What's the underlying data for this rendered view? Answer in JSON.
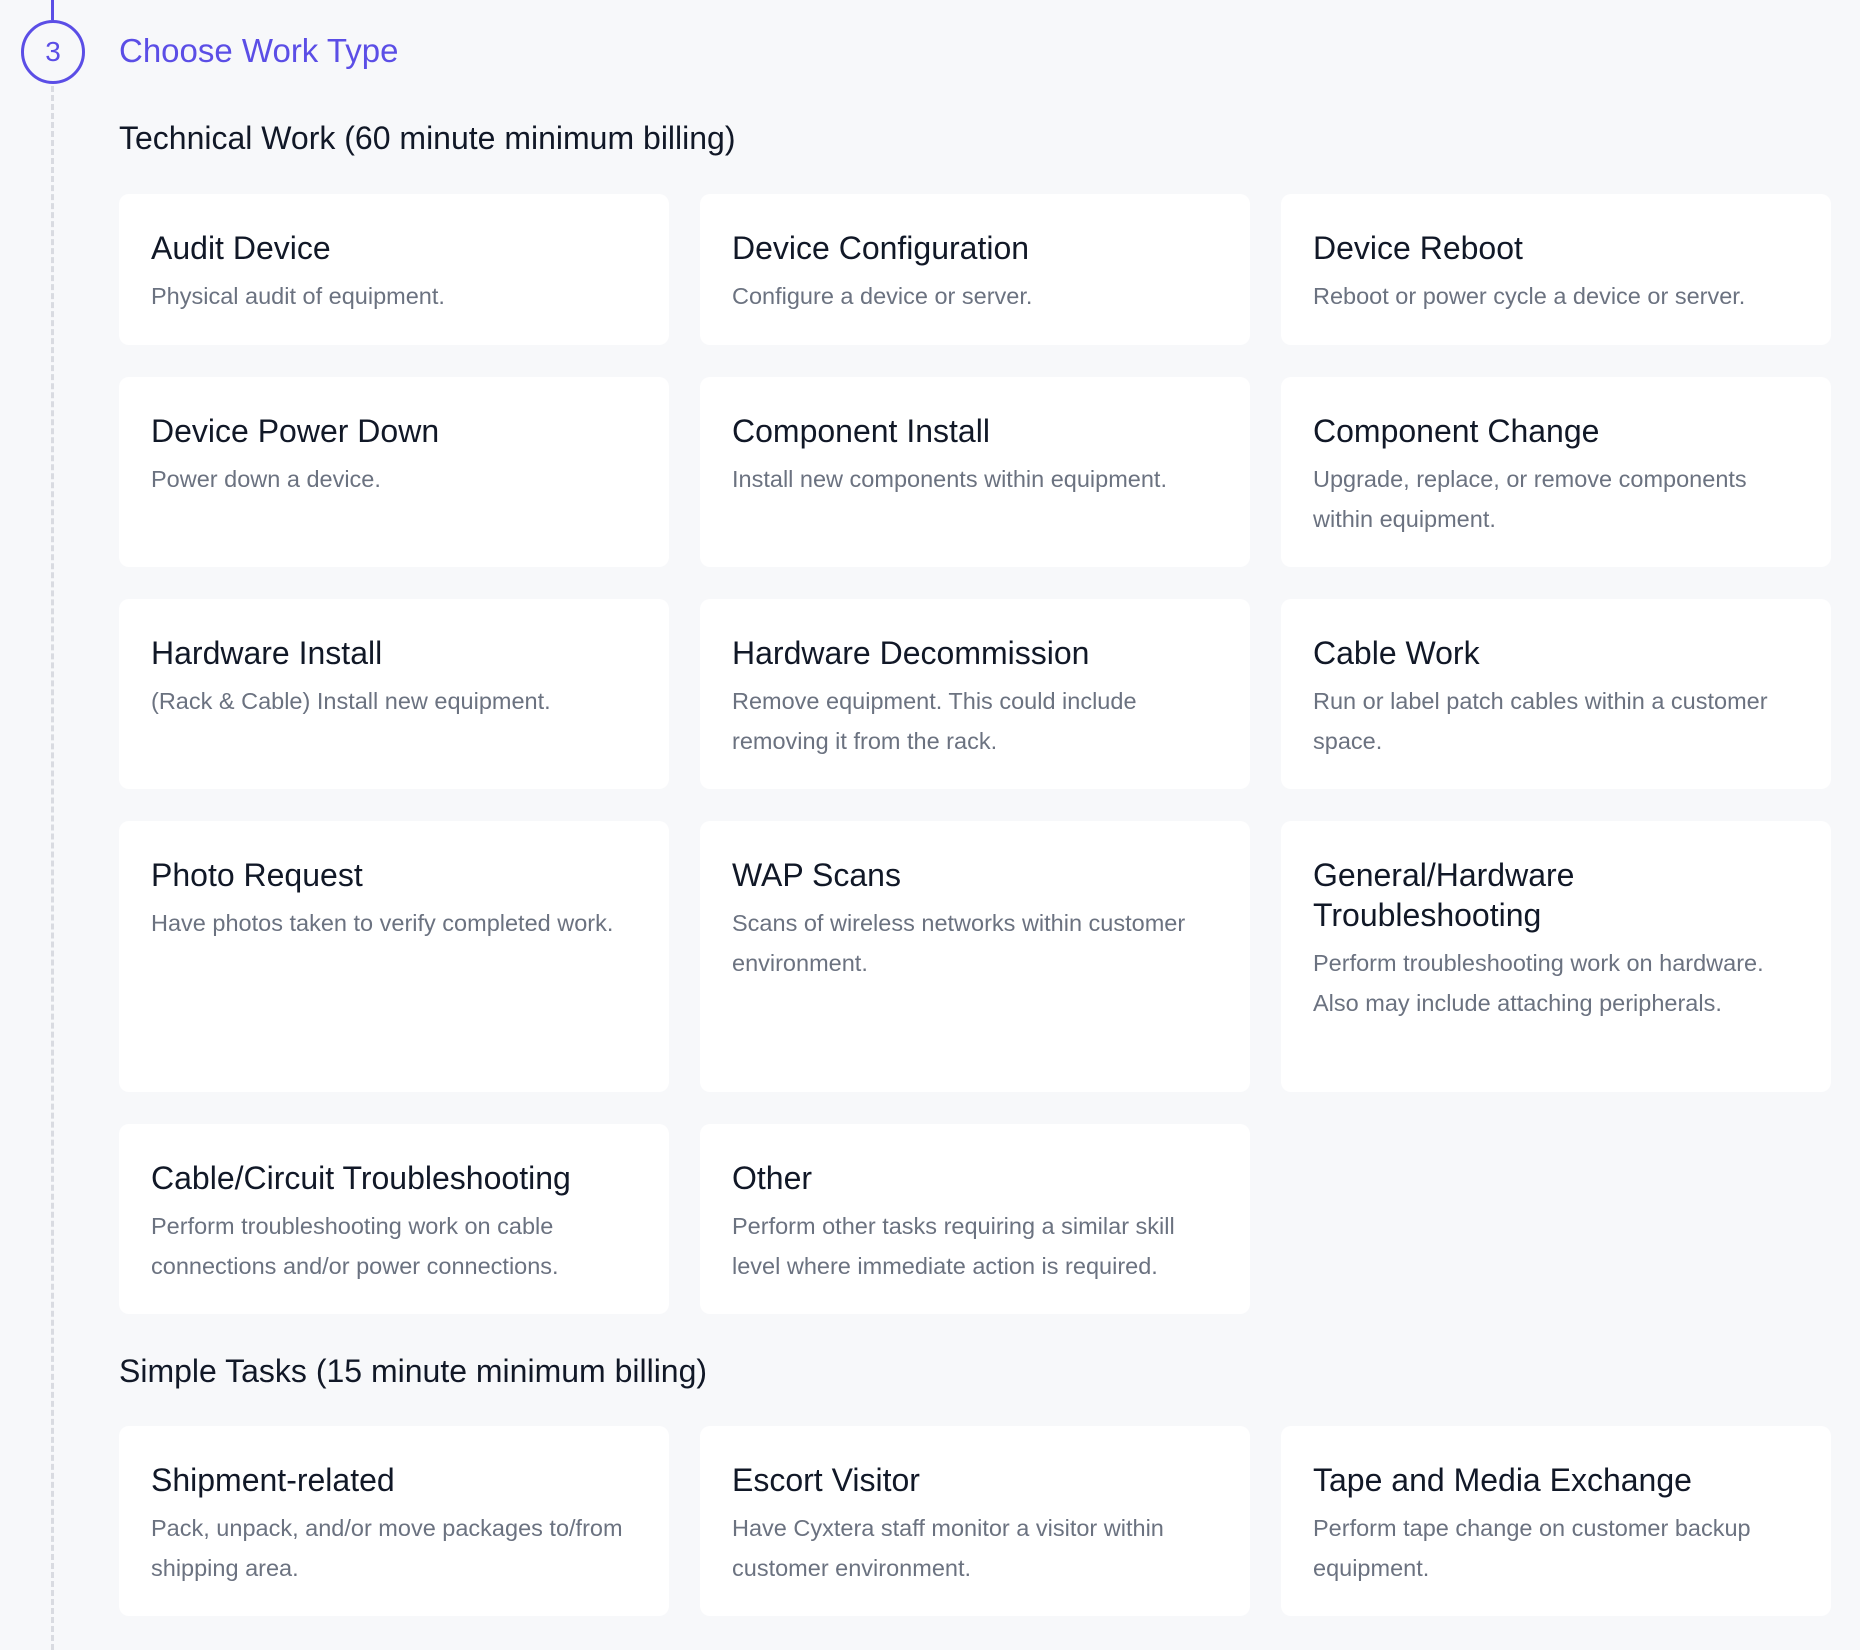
{
  "step": {
    "number": "3",
    "title": "Choose Work Type"
  },
  "sections": [
    {
      "title": "Technical Work (60 minute minimum billing)",
      "cards": [
        {
          "title": "Audit Device",
          "desc": "Physical audit of equipment."
        },
        {
          "title": "Device Configuration",
          "desc": "Configure a device or server."
        },
        {
          "title": "Device Reboot",
          "desc": "Reboot or power cycle a device or server."
        },
        {
          "title": "Device Power Down",
          "desc": "Power down a device."
        },
        {
          "title": "Component Install",
          "desc": "Install new components within equipment."
        },
        {
          "title": "Component Change",
          "desc": "Upgrade, replace, or remove components within equipment."
        },
        {
          "title": "Hardware Install",
          "desc": "(Rack & Cable) Install new equipment."
        },
        {
          "title": "Hardware Decommission",
          "desc": "Remove equipment. This could include removing it from the rack."
        },
        {
          "title": "Cable Work",
          "desc": "Run or label patch cables within a customer space."
        },
        {
          "title": "Photo Request",
          "desc": "Have photos taken to verify completed work."
        },
        {
          "title": "WAP Scans",
          "desc": "Scans of wireless networks within customer environment."
        },
        {
          "title": "General/Hardware Troubleshooting",
          "desc": "Perform troubleshooting work on hardware. Also may include attaching peripherals."
        },
        {
          "title": "Cable/Circuit Troubleshooting",
          "desc": "Perform troubleshooting work on cable connections and/or power connections."
        },
        {
          "title": "Other",
          "desc": "Perform other tasks requiring a similar skill level where immediate action is required."
        }
      ]
    },
    {
      "title": "Simple Tasks (15 minute minimum billing)",
      "cards": [
        {
          "title": "Shipment-related",
          "desc": "Pack, unpack, and/or move packages to/from shipping area."
        },
        {
          "title": "Escort Visitor",
          "desc": "Have Cyxtera staff monitor a visitor within customer environment."
        },
        {
          "title": "Tape and Media Exchange",
          "desc": "Perform tape change on customer backup equipment."
        }
      ]
    }
  ]
}
